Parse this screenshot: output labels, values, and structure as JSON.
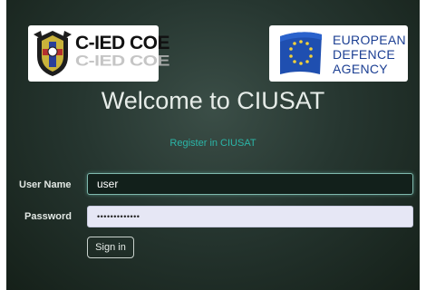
{
  "logos": {
    "cied_text": "C-IED COE",
    "eda_lines": [
      "EUROPEAN",
      "DEFENCE",
      "AGENCY"
    ]
  },
  "welcome_title": "Welcome to CIUSAT",
  "register_link": "Register in CIUSAT",
  "form": {
    "username_label": "User Name",
    "username_value": "user",
    "password_label": "Password",
    "password_value": "•••••••••••••",
    "signin_label": "Sign in"
  },
  "colors": {
    "background": "#263630",
    "accent": "#2bb5a7",
    "eda_blue": "#1c3f93"
  }
}
